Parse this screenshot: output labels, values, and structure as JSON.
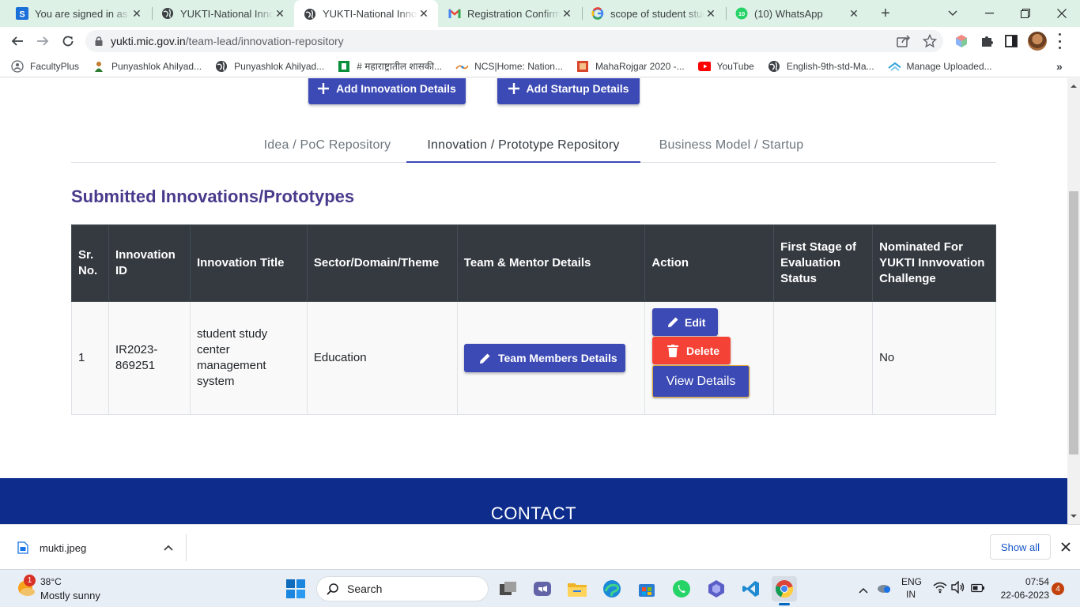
{
  "browser": {
    "tabs": [
      {
        "title": "You are signed in as co",
        "icon": "s-favicon",
        "active": false
      },
      {
        "title": "YUKTI-National Innova",
        "icon": "globe-icon",
        "active": false
      },
      {
        "title": "YUKTI-National Innova",
        "icon": "globe-icon",
        "active": true
      },
      {
        "title": "Registration Confirme",
        "icon": "gmail-icon",
        "active": false
      },
      {
        "title": "scope of student study",
        "icon": "google-icon",
        "active": false
      },
      {
        "title": "(10) WhatsApp",
        "icon": "whatsapp-icon",
        "badge": "10",
        "active": false
      }
    ],
    "url_host": "yukti.mic.gov.in",
    "url_path": "/team-lead/innovation-repository",
    "bookmarks": [
      {
        "label": "FacultyPlus",
        "icon": "faculty-icon"
      },
      {
        "label": "Punyashlok Ahilyad...",
        "icon": "university-icon"
      },
      {
        "label": "Punyashlok Ahilyad...",
        "icon": "globe-icon"
      },
      {
        "label": "# महाराष्ट्रातील शासकी...",
        "icon": "green-square-icon"
      },
      {
        "label": "NCS|Home: Nation...",
        "icon": "ncs-icon"
      },
      {
        "label": "MahaRojgar 2020 -...",
        "icon": "maharojgar-icon"
      },
      {
        "label": "YouTube",
        "icon": "youtube-icon"
      },
      {
        "label": "English-9th-std-Ma...",
        "icon": "globe-icon"
      },
      {
        "label": "Manage Uploaded...",
        "icon": "upload-icon"
      }
    ]
  },
  "page": {
    "add_innovation_label": "Add Innovation Details",
    "add_startup_label": "Add Startup Details",
    "nav_tabs": [
      {
        "label": "Idea / PoC Repository",
        "active": false
      },
      {
        "label": "Innovation / Prototype Repository",
        "active": true
      },
      {
        "label": "Business Model / Startup",
        "active": false
      }
    ],
    "section_title": "Submitted Innovations/Prototypes",
    "table": {
      "headers": [
        "Sr. No.",
        "Innovation ID",
        "Innovation Title",
        "Sector/Domain/Theme",
        "Team & Mentor Details",
        "Action",
        "First Stage of Evaluation Status",
        "Nominated For YUKTI Innvovation Challenge"
      ],
      "rows": [
        {
          "sr": "1",
          "id": "IR2023-869251",
          "title": "student study center management system",
          "sector": "Education",
          "team_button": "Team Members Details",
          "edit": "Edit",
          "delete": "Delete",
          "view": "View Details",
          "evaluation_status": "",
          "nominated": "No"
        }
      ]
    },
    "footer_heading": "CONTACT"
  },
  "downloads": {
    "file": "mukti.jpeg",
    "show_all": "Show all"
  },
  "taskbar": {
    "weather_temp": "38°C",
    "weather_desc": "Mostly sunny",
    "weather_badge": "1",
    "search_label": "Search",
    "lang1": "ENG",
    "lang2": "IN",
    "time": "07:54",
    "date": "22-06-2023",
    "notification_count": "4"
  },
  "colors": {
    "primary": "#3c4ab5",
    "danger": "#f44336",
    "footer": "#0d2c8c",
    "title": "#4a3a8c",
    "table_header": "#343a40"
  }
}
